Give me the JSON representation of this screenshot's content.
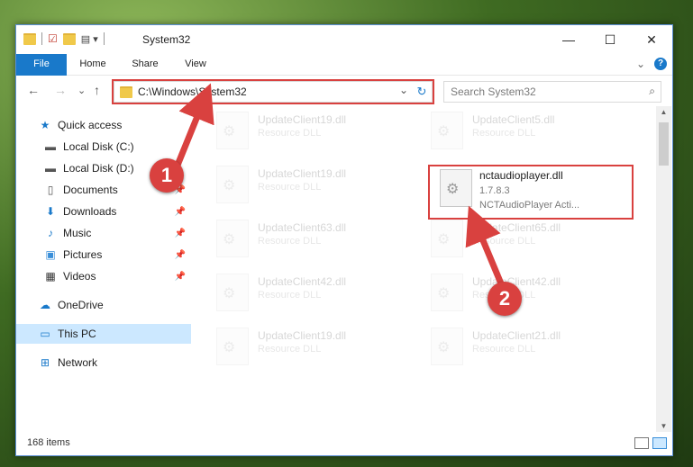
{
  "titlebar": {
    "title": "System32",
    "minimize": "—",
    "maximize": "☐",
    "close": "✕"
  },
  "ribbon": {
    "tabs": [
      "File",
      "Home",
      "Share",
      "View"
    ],
    "expand": "⌄",
    "help": "?"
  },
  "nav": {
    "back": "←",
    "forward": "→",
    "recent": "⌄",
    "up": "↑",
    "address": "C:\\Windows\\System32",
    "address_dropdown": "⌄",
    "refresh": "↻",
    "search_placeholder": "Search System32"
  },
  "sidebar": {
    "items": [
      {
        "label": "Quick access",
        "icon": "star-icon"
      },
      {
        "label": "Local Disk (C:)",
        "icon": "drive-icon"
      },
      {
        "label": "Local Disk (D:)",
        "icon": "drive-icon"
      },
      {
        "label": "Documents",
        "icon": "document-icon"
      },
      {
        "label": "Downloads",
        "icon": "download-icon"
      },
      {
        "label": "Music",
        "icon": "music-icon"
      },
      {
        "label": "Pictures",
        "icon": "pictures-icon"
      },
      {
        "label": "Videos",
        "icon": "videos-icon"
      },
      {
        "label": "OneDrive",
        "icon": "cloud-icon"
      },
      {
        "label": "This PC",
        "icon": "computer-icon"
      },
      {
        "label": "Network",
        "icon": "network-icon"
      }
    ]
  },
  "files": {
    "left": [
      {
        "name": "UpdateClient19.dll",
        "type": "Resource DLL"
      },
      {
        "name": "UpdateClient19.dll",
        "type": "Resource DLL"
      },
      {
        "name": "UpdateClient63.dll",
        "type": "Resource DLL"
      },
      {
        "name": "UpdateClient42.dll",
        "type": "Resource DLL"
      },
      {
        "name": "UpdateClient19.dll",
        "type": "Resource DLL"
      }
    ],
    "right": [
      {
        "name": "UpdateClient5.dll",
        "type": "Resource DLL"
      },
      {
        "name": "UpdateClient65.dll",
        "type": "Resource DLL"
      },
      {
        "name": "UpdateClient42.dll",
        "type": "Resource DLL"
      },
      {
        "name": "UpdateClient21.dll",
        "type": "Resource DLL"
      }
    ],
    "highlighted": {
      "name": "nctaudioplayer.dll",
      "version": "1.7.8.3",
      "description": "NCTAudioPlayer Acti..."
    }
  },
  "status": {
    "item_count": "168 items"
  },
  "callouts": {
    "one": "1",
    "two": "2"
  },
  "colors": {
    "accent": "#1979ca",
    "highlight": "#d9413f",
    "selection": "#cce8ff"
  }
}
